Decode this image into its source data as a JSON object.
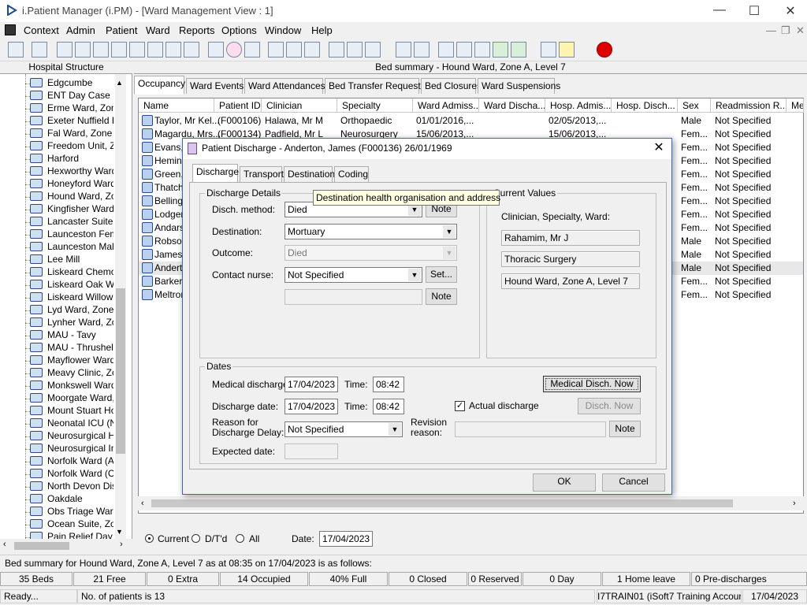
{
  "window": {
    "title": "i.Patient Manager (i.PM) - [Ward Management View : 1]"
  },
  "menu": [
    "Context",
    "Admin",
    "Patient",
    "Ward",
    "Reports",
    "Options",
    "Window",
    "Help"
  ],
  "left": {
    "header": "Hospital Structure",
    "wards": [
      "Edgcumbe",
      "ENT Day Case U",
      "Erme Ward, Zone",
      "Exeter Nuffield H",
      "Fal Ward, Zone E",
      "Freedom Unit, Zo",
      "Harford",
      "Hexworthy Ward,",
      "Honeyford Ward,",
      "Hound Ward, Zo",
      "Kingfisher Ward",
      "Lancaster Suite, Z",
      "Launceston Fema",
      "Launceston Male",
      "Lee Mill",
      "Liskeard Chemo D",
      "Liskeard Oak Wa",
      "Liskeard Willow V",
      "Lyd Ward, Zone I",
      "Lynher Ward, Zo",
      "MAU - Tavy",
      "MAU - Thrushel",
      "Mayflower Ward,",
      "Meavy Clinic, Zo",
      "Monkswell Ward,",
      "Moorgate Ward,",
      "Mount Stuart Ho",
      "Neonatal ICU (NN",
      "Neurosurgical Hi",
      "Neurosurgical Int",
      "Norfolk Ward (Ad",
      "Norfolk Ward (Co",
      "North Devon Dist",
      "Oakdale",
      "Obs Triage Ward",
      "Ocean Suite, Zo",
      "Pain Relief Day C"
    ]
  },
  "bed_summary": {
    "header": "Bed summary - Hound Ward, Zone A, Level 7"
  },
  "tabs": [
    "Occupancy",
    "Ward Events",
    "Ward Attendances",
    "Bed Transfer Requests",
    "Bed Closures",
    "Ward Suspensions"
  ],
  "grid": {
    "columns": [
      "Name",
      "Patient ID",
      "Clinician",
      "Specialty",
      "Ward Admiss...",
      "Ward Discha...",
      "Hosp. Admis...",
      "Hosp. Disch...",
      "Sex",
      "Readmission R...",
      "Me"
    ],
    "rows": [
      {
        "name": "Taylor, Mr Kel...",
        "pid": "(F000106)",
        "clin": "Halawa, Mr M",
        "spec": "Orthopaedic",
        "wadm": "01/01/2016,...",
        "hadm": "02/05/2013,...",
        "sex": "Male",
        "readm": "Not Specified"
      },
      {
        "name": "Magardu, Mrs...",
        "pid": "(F000134)",
        "clin": "Padfield, Mr L",
        "spec": "Neurosurgery",
        "wadm": "15/06/2013,...",
        "hadm": "15/06/2013,...",
        "sex": "Fem...",
        "readm": "Not Specified"
      },
      {
        "name": "Evans,",
        "sex": "Fem...",
        "readm": "Not Specified"
      },
      {
        "name": "Heming",
        "sex": "Fem...",
        "readm": "Not Specified"
      },
      {
        "name": "Green,",
        "sex": "Fem...",
        "readm": "Not Specified"
      },
      {
        "name": "Thatch",
        "sex": "Fem...",
        "readm": "Not Specified"
      },
      {
        "name": "Bellingh",
        "sex": "Fem...",
        "readm": "Not Specified"
      },
      {
        "name": "Lodger,",
        "sex": "Fem...",
        "readm": "Not Specified"
      },
      {
        "name": "Andars,",
        "sex": "Fem...",
        "readm": "Not Specified"
      },
      {
        "name": "Robson",
        "sex": "Male",
        "readm": "Not Specified"
      },
      {
        "name": "James,",
        "sex": "Male",
        "readm": "Not Specified"
      },
      {
        "name": "Andert",
        "sex": "Male",
        "readm": "Not Specified"
      },
      {
        "name": "Barker,",
        "sex": "Fem...",
        "readm": "Not Specified"
      },
      {
        "name": "Meltrori",
        "sex": "Fem...",
        "readm": "Not Specified"
      }
    ]
  },
  "filter": {
    "current": "Current",
    "dtd": "D/T'd",
    "all": "All",
    "date_label": "Date:",
    "date": "17/04/2023"
  },
  "status": {
    "line1": "Bed summary for Hound Ward, Zone A, Level 7 as at 08:35 on 17/04/2023 is as follows:",
    "boxes": [
      "35 Beds",
      "21 Free",
      "0 Extra",
      "14 Occupied",
      "40% Full",
      "0 Closed",
      "0 Reserved",
      "0 Day",
      "1 Home leave",
      "0 Pre-discharges"
    ],
    "ready": "Ready...",
    "patients": "No. of patients is 13",
    "account": "I7TRAIN01 (iSoft7 Training Account)",
    "date": "17/04/2023"
  },
  "dialog": {
    "title": "Patient Discharge - Anderton, James (F000136) 26/01/1969",
    "tabs": [
      "Discharge",
      "Transport",
      "Destination",
      "Coding"
    ],
    "details_group": "Discharge Details",
    "disch_method_label": "Disch. method:",
    "disch_method": "Died",
    "destination_label": "Destination:",
    "destination": "Mortuary",
    "outcome_label": "Outcome:",
    "outcome": "Died",
    "contact_label": "Contact nurse:",
    "contact": "Not Specified",
    "note": "Note",
    "set": "Set...",
    "current_group": "Current Values",
    "cur_label": "Clinician, Specialty, Ward:",
    "cur_clin": "Rahamim, Mr J",
    "cur_spec": "Thoracic Surgery",
    "cur_ward": "Hound Ward, Zone A, Level 7",
    "dates_group": "Dates",
    "med_label": "Medical discharge:",
    "med_date": "17/04/2023",
    "time_label": "Time:",
    "med_time": "08:42",
    "med_now": "Medical Disch. Now",
    "dis_label": "Discharge date:",
    "dis_date": "17/04/2023",
    "dis_time": "08:42",
    "actual": "Actual discharge",
    "disch_now": "Disch. Now",
    "reason_label1": "Reason for",
    "reason_label2": "Discharge Delay:",
    "reason": "Not Specified",
    "rev_label1": "Revision",
    "rev_label2": "reason:",
    "expected_label": "Expected date:",
    "ok": "OK",
    "cancel": "Cancel"
  },
  "tooltip": "Destination health organisation and address"
}
